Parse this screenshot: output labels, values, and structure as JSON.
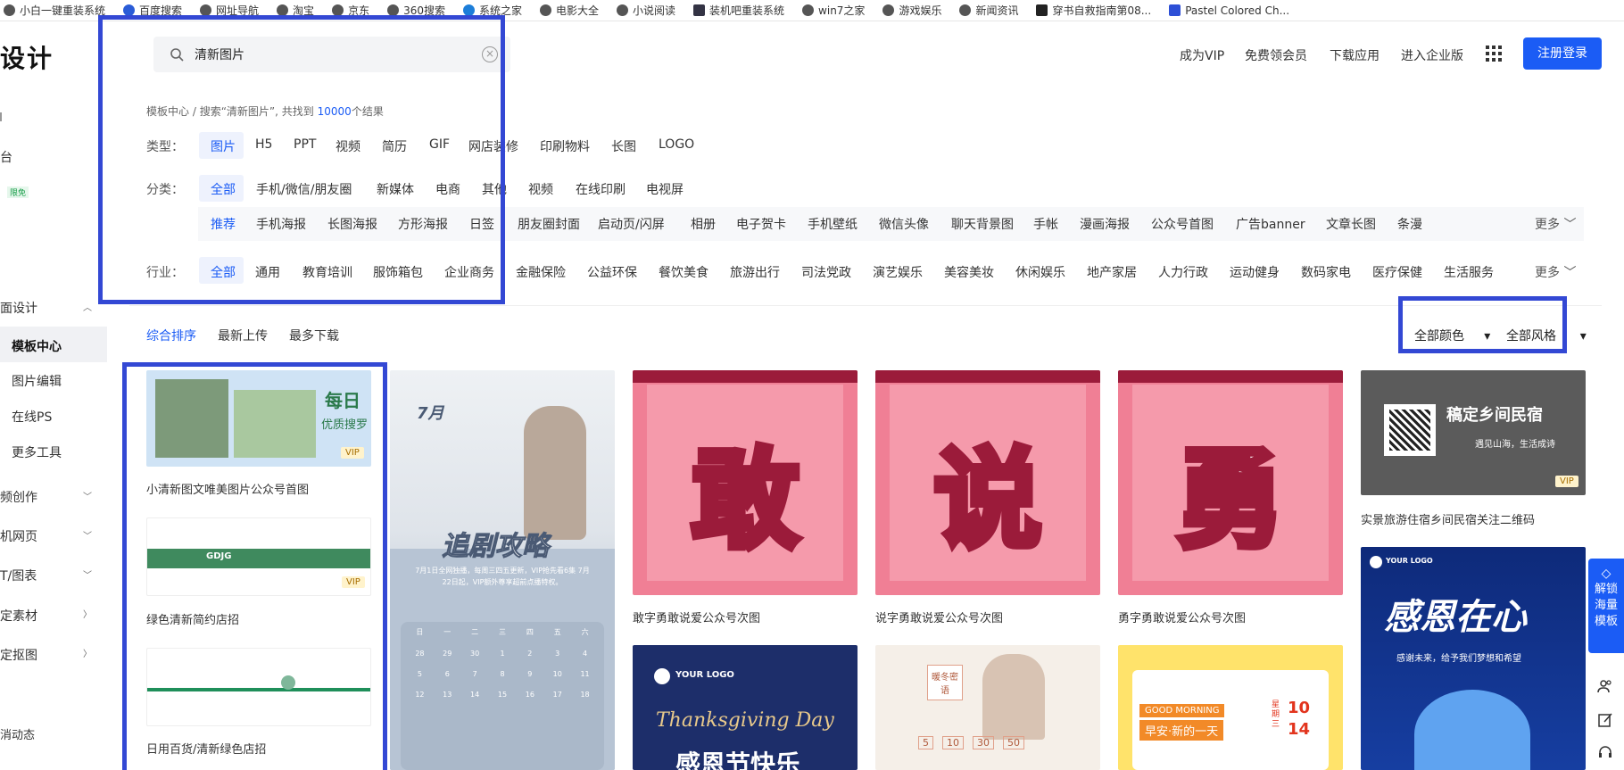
{
  "bookmarks": [
    "小白一键重装系统",
    "百度搜索",
    "网址导航",
    "淘宝",
    "京东",
    "360搜索",
    "系统之家",
    "电影大全",
    "小说阅读",
    "装机吧重装系统",
    "win7之家",
    "游戏娱乐",
    "新闻资讯",
    "穿书自救指南第08...",
    "Pastel Colored Ch..."
  ],
  "header": {
    "logo_text": "设计",
    "search_value": "清新图片",
    "links": [
      "成为VIP",
      "免费领会员",
      "下载应用",
      "进入企业版"
    ],
    "login": "注册登录"
  },
  "sidebar": {
    "top_items": [
      "台",
      "限免"
    ],
    "section_title": "面设计",
    "sub_items": [
      "模板中心",
      "图片编辑",
      "在线PS",
      "更多工具"
    ],
    "groups": [
      "频创作",
      "机网页",
      "T/图表",
      "定素材",
      "定抠图"
    ],
    "bottom": "消动态"
  },
  "breadcrumb": {
    "root": "模板中心",
    "sep": "/",
    "prefix": "搜索“清新图片”, 共找到",
    "count": "10000",
    "suffix": "个结果"
  },
  "filters": {
    "type_label": "类型：",
    "types": [
      "图片",
      "H5",
      "PPT",
      "视频",
      "简历",
      "GIF",
      "网店装修",
      "印刷物料",
      "长图",
      "LOGO"
    ],
    "category_label": "分类：",
    "categories": [
      "全部",
      "手机/微信/朋友圈",
      "新媒体",
      "电商",
      "其他",
      "视频",
      "在线印刷",
      "电视屏"
    ],
    "subcategories": [
      "推荐",
      "手机海报",
      "长图海报",
      "方形海报",
      "日签",
      "朋友圈封面",
      "启动页/闪屏",
      "相册",
      "电子贺卡",
      "手机壁纸",
      "微信头像",
      "聊天背景图",
      "手帐",
      "漫画海报",
      "公众号首图",
      "广告banner",
      "文章长图",
      "条漫"
    ],
    "industry_label": "行业：",
    "industries": [
      "全部",
      "通用",
      "教育培训",
      "服饰箱包",
      "企业商务",
      "金融保险",
      "公益环保",
      "餐饮美食",
      "旅游出行",
      "司法党政",
      "演艺娱乐",
      "美容美妆",
      "休闲娱乐",
      "地产家居",
      "人力行政",
      "运动健身",
      "数码家电",
      "医疗保健",
      "生活服务"
    ],
    "more": "更多"
  },
  "sort": {
    "options": [
      "综合排序",
      "最新上传",
      "最多下载"
    ],
    "color": "全部颜色",
    "style": "全部风格"
  },
  "cards": {
    "c1_title": "每日",
    "c1_sub": "优质搜罗",
    "c1_caption": "小清新图文唯美图片公众号首图",
    "c2_caption": "绿色清新简约店招",
    "c2_logo": "GDJG",
    "c3_caption": "日用百货/清新绿色店招",
    "poster_month": "7月",
    "poster_title": "追剧攻略",
    "poster_sub": "7月1日全网独播，每周三四五更新，VIP抢先看6集 7月22日起，VIP额外尊享超前点播特权。",
    "cal_week": [
      "日",
      "一",
      "二",
      "三",
      "四",
      "五",
      "六"
    ],
    "cal_dates": [
      [
        "28",
        "29",
        "30",
        "1",
        "2",
        "3",
        "4"
      ],
      [
        "5",
        "6",
        "7",
        "8",
        "9",
        "10",
        "11"
      ],
      [
        "12",
        "13",
        "14",
        "15",
        "16",
        "17",
        "18"
      ]
    ],
    "big1": "敢",
    "big1_caption": "敢字勇敢说爱公众号次图",
    "big2": "说",
    "big2_caption": "说字勇敢说爱公众号次图",
    "big3": "勇",
    "big3_caption": "勇字勇敢说爱公众号次图",
    "qr_title": "稿定乡间民宿",
    "qr_sub": "遇见山海，生活成诗",
    "qr_caption": "实景旅游住宿乡间民宿关注二维码",
    "thanks_logo": "YOUR LOGO",
    "thanks_en": "Thanksgiving Day",
    "thanks_cn": "感恩节快乐",
    "gift_title": "暖冬密语",
    "gift_prices": [
      "5",
      "10",
      "30",
      "50"
    ],
    "morning_en": "GOOD MORNING",
    "morning_cn": "早安·新的一天",
    "morning_date": "10",
    "morning_date2": "14",
    "morning_week": "星期三",
    "grat_logo": "YOUR LOGO",
    "grat_title": "感恩在心",
    "grat_sub": "感谢未来，给予我们梦想和希望",
    "vip": "VIP"
  },
  "unlock": "解锁海量模板",
  "colors": {
    "accent": "#1b5cf5",
    "highlight": "#3348d4"
  }
}
